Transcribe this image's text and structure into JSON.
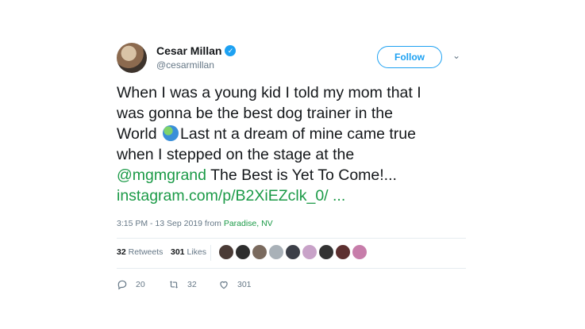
{
  "user": {
    "name": "Cesar Millan",
    "handle": "@cesarmillan",
    "follow_label": "Follow"
  },
  "tweet": {
    "line1": "When I was a young kid I told my mom that I",
    "line2": "was gonna be the best dog trainer in the",
    "line3_a": "World ",
    "line3_b": "Last nt a dream of mine came true",
    "line4": "when I stepped on the stage at the",
    "mention": "@mgmgrand",
    "line5_rest": " The Best is Yet To Come!...",
    "link": "instagram.com/p/B2XiEZclk_0/ ..."
  },
  "meta": {
    "time": "3:15 PM - 13 Sep 2019 from ",
    "location": "Paradise, NV"
  },
  "stats": {
    "retweets_count": "32",
    "retweets_label": "Retweets",
    "likes_count": "301",
    "likes_label": "Likes"
  },
  "likers": [
    {
      "color": "#4a3b36"
    },
    {
      "color": "#2d2d2d"
    },
    {
      "color": "#7a6a5e"
    },
    {
      "color": "#a9b1b8"
    },
    {
      "color": "#3c3f48"
    },
    {
      "color": "#c8a2c8"
    },
    {
      "color": "#333333"
    },
    {
      "color": "#5c2f2f"
    },
    {
      "color": "#c77daa"
    }
  ],
  "actions": {
    "reply_count": "20",
    "retweet_count": "32",
    "like_count": "301"
  },
  "icons": {
    "verified": "verified-check-icon",
    "caret": "chevron-down-icon",
    "globe": "globe-emoji-icon",
    "reply": "reply-icon",
    "retweet": "retweet-icon",
    "like": "heart-icon"
  },
  "colors": {
    "accent": "#1da1f2",
    "link": "#1b9a47",
    "muted": "#657786"
  }
}
